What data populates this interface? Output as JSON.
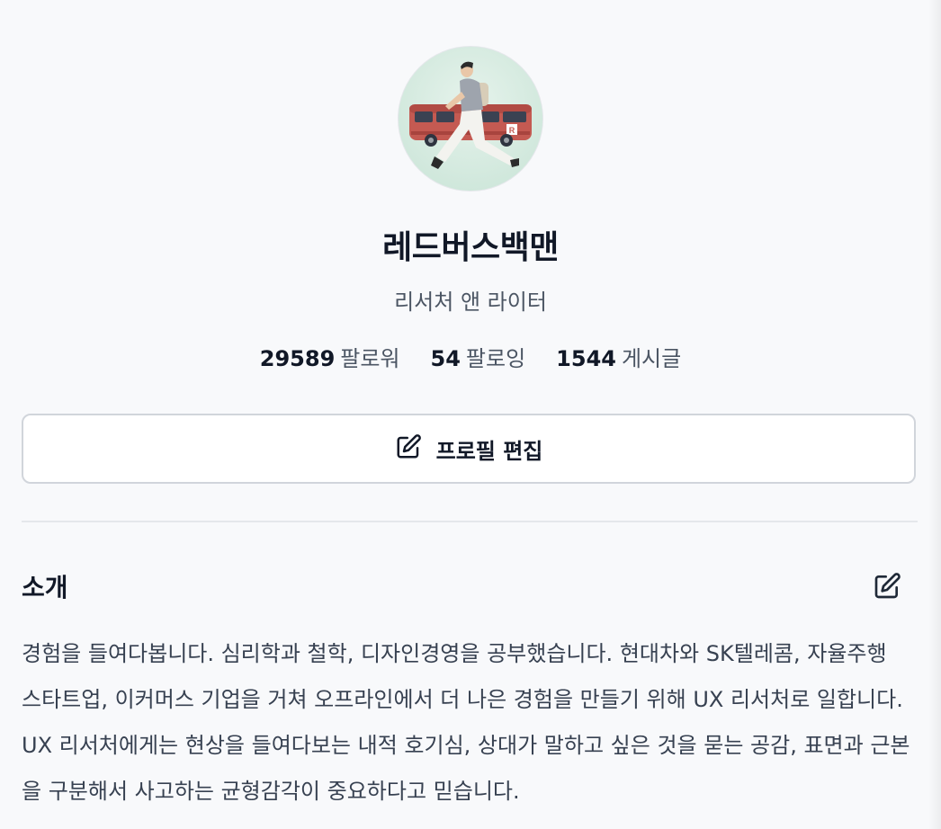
{
  "profile": {
    "avatar_icon": "bus-walker-illustration",
    "name": "레드버스백맨",
    "role": "리서처 앤 라이터",
    "stats": [
      {
        "value": "29589",
        "label": "팔로워"
      },
      {
        "value": "54",
        "label": "팔로잉"
      },
      {
        "value": "1544",
        "label": "게시글"
      }
    ]
  },
  "actions": {
    "edit_profile_label": "프로필 편집",
    "edit_icon": "pencil-square-icon"
  },
  "intro": {
    "title": "소개",
    "body": "경험을 들여다봅니다. 심리학과 철학, 디자인경영을 공부했습니다. 현대차와 SK텔레콤, 자율주행 스타트업, 이커머스 기업을 거쳐 오프라인에서 더 나은 경험을 만들기 위해 UX 리서처로 일합니다. UX 리서처에게는 현상을 들여다보는 내적 호기심, 상대가 말하고 싶은 것을 묻는 공감, 표면과 근본을 구분해서 사고하는 균형감각이 중요하다고 믿습니다."
  },
  "colors": {
    "background": "#f8f9fb",
    "bus_red": "#c45a52",
    "avatar_bg": "#d5ece2"
  }
}
